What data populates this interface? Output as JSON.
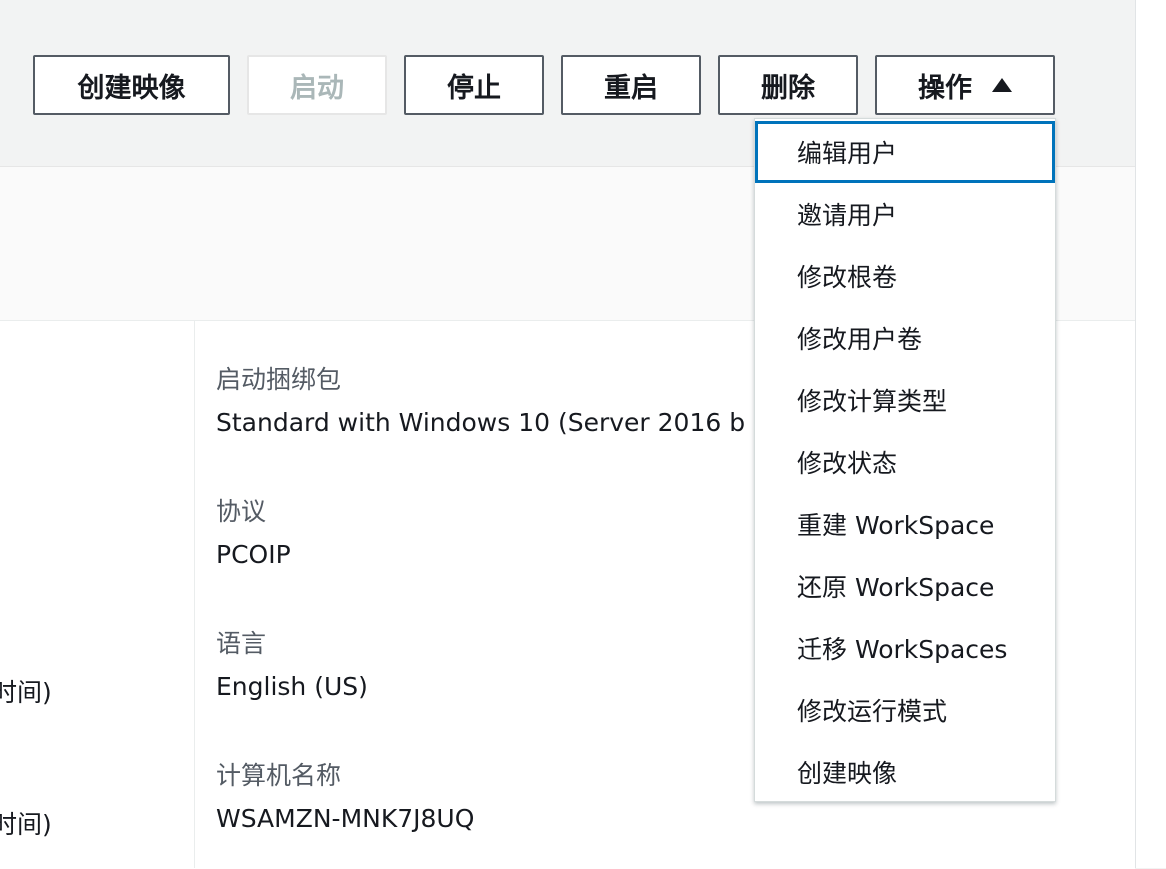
{
  "toolbar": {
    "create_image": "创建映像",
    "start": "启动",
    "stop": "停止",
    "reboot": "重启",
    "delete": "删除",
    "actions": "操作"
  },
  "actions_menu": {
    "items": [
      "编辑用户",
      "邀请用户",
      "修改根卷",
      "修改用户卷",
      "修改计算类型",
      "修改状态",
      "重建 WorkSpace",
      "还原 WorkSpace",
      "迁移 WorkSpaces",
      "修改运行模式",
      "创建映像"
    ],
    "focused_index": 0
  },
  "details": {
    "bundle_label": "启动捆绑包",
    "bundle_value": "Standard with Windows 10 (Server 2016 b",
    "protocol_label": "协议",
    "protocol_value": "PCOIP",
    "language_label": "语言",
    "language_value": "English (US)",
    "computer_name_label": "计算机名称",
    "computer_name_value": "WSAMZN-MNK7J8UQ"
  },
  "left_column": {
    "time_text_1": "时间)",
    "time_text_2": "时间)"
  },
  "colors": {
    "focus_border": "#0073bb",
    "button_border": "#545b64",
    "disabled_text": "#aab7b8"
  }
}
